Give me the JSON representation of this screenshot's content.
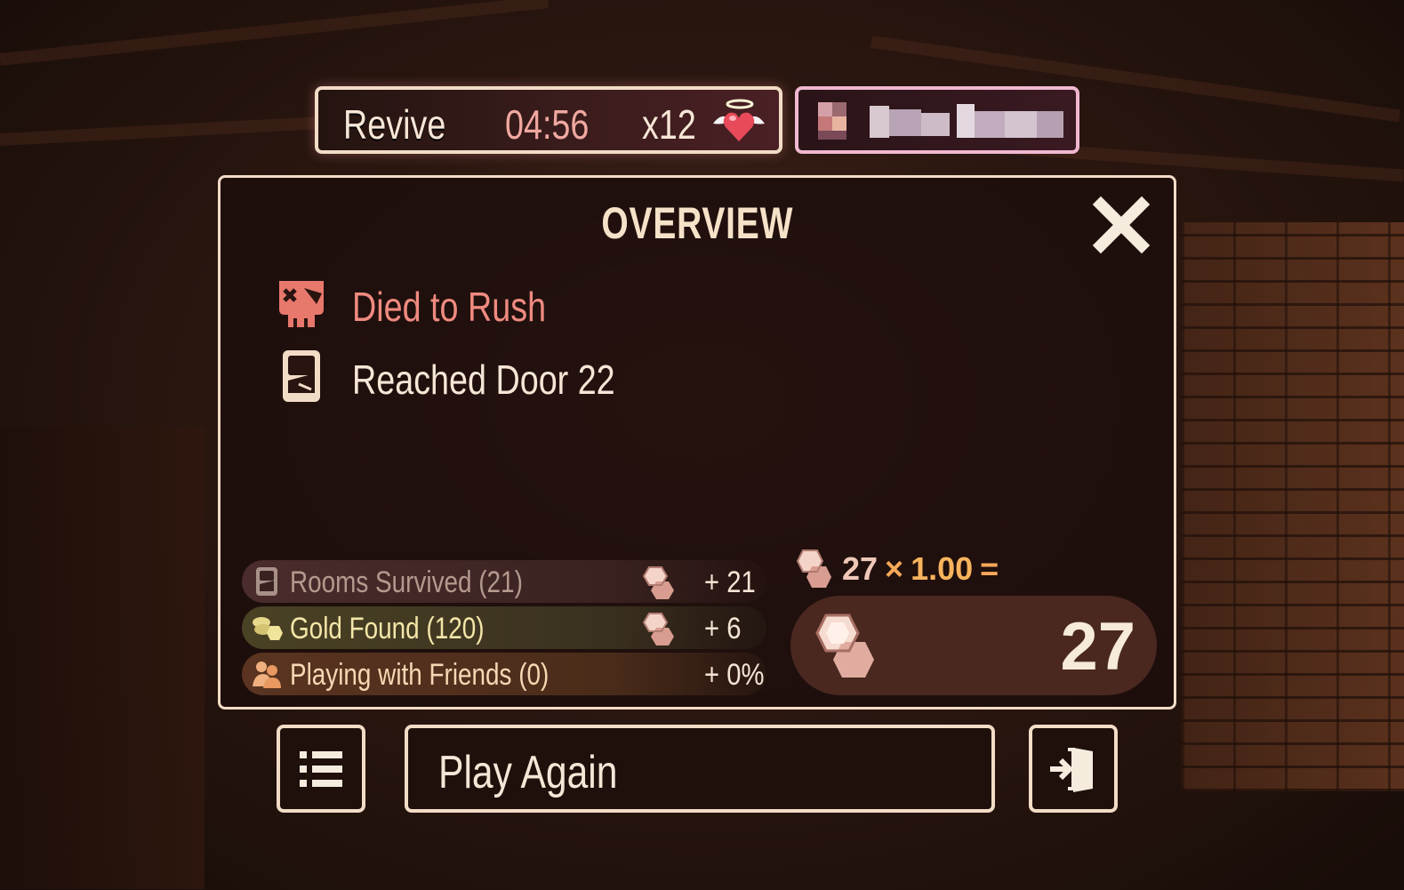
{
  "revive": {
    "label": "Revive",
    "timer": "04:56",
    "count": "x12",
    "icon": "winged-heart-icon"
  },
  "player": {
    "avatar_icon": "avatar-icon",
    "name_redacted": true
  },
  "overview": {
    "title": "OVERVIEW",
    "close_icon": "close-icon",
    "death": {
      "icon": "skull-icon",
      "text": "Died to Rush"
    },
    "door": {
      "icon": "door-icon",
      "text": "Reached Door 22"
    },
    "stats": [
      {
        "icon": "door-icon",
        "label": "Rooms Survived (21)",
        "gem_icon": "knob-icon",
        "value": "+ 21",
        "color": "#b39a8e"
      },
      {
        "icon": "gold-coins-icon",
        "label": "Gold Found (120)",
        "gem_icon": "knob-icon",
        "value": "+ 6",
        "color": "#f4e6a8"
      },
      {
        "icon": "friends-icon",
        "label": "Playing with Friends (0)",
        "value": "+ 0%",
        "color": "#f6d8b4"
      }
    ],
    "formula": {
      "base": "27",
      "multiply_sign": "×",
      "multiplier": "1.00",
      "equals": "="
    },
    "total": "27"
  },
  "buttons": {
    "list_icon": "list-icon",
    "play_again": "Play Again",
    "exit_icon": "exit-door-icon"
  },
  "colors": {
    "accent_cream": "#f3dcc6",
    "death_red": "#f08a80",
    "multiplier_orange": "#f8b45c"
  }
}
